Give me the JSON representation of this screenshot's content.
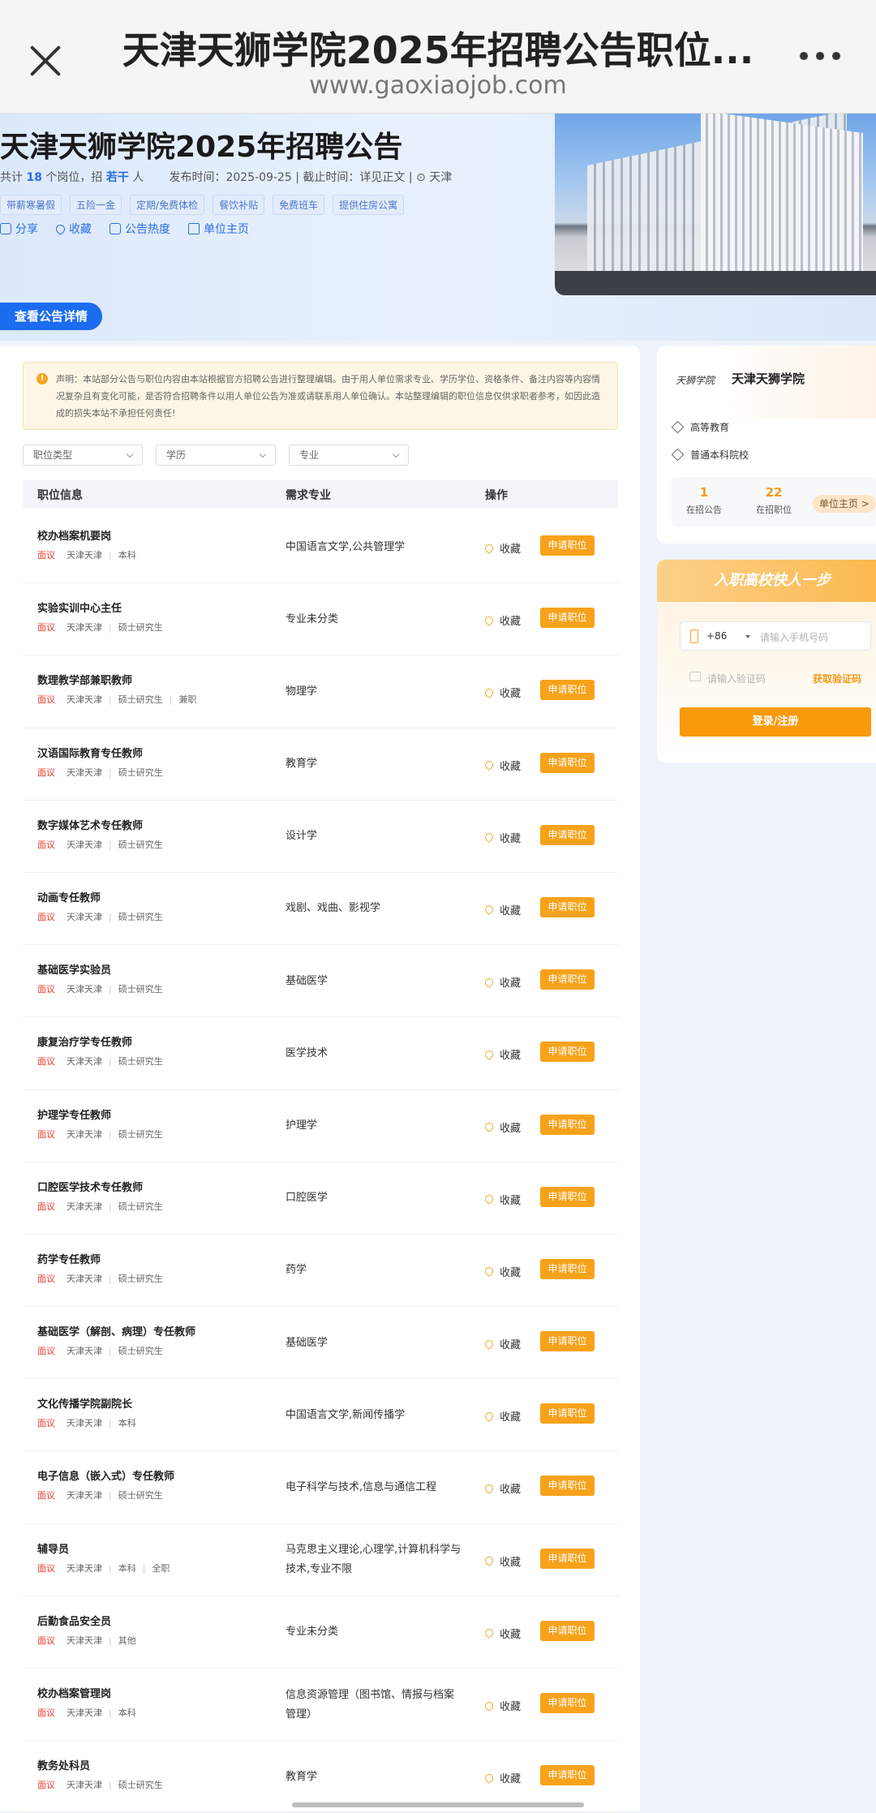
{
  "browser": {
    "title": "天津天狮学院2025年招聘公告职位...",
    "url": "www.gaoxiaojob.com"
  },
  "hero": {
    "title": "天津天狮学院2025年招聘公告",
    "meta_prefix": "共计",
    "positions_count": "18",
    "meta_mid": "个岗位，招",
    "people": "若干",
    "meta_suffix": "人",
    "publish_time": "发布时间：2025-09-25 | 截止时间：详见正文 |",
    "location": "天津",
    "tags": [
      "带薪寒暑假",
      "五险一金",
      "定期/免费体检",
      "餐饮补贴",
      "免费班车",
      "提供住房公寓"
    ],
    "actions": {
      "share": "分享",
      "favorite": "收藏",
      "heat": "公告热度",
      "unit_home": "单位主页"
    },
    "detail_button": "查看公告详情"
  },
  "notice": "声明：本站部分公告与职位内容由本站根据官方招聘公告进行整理编辑。由于用人单位需求专业、学历学位、资格条件、备注内容等内容情况复杂且有变化可能，是否符合招聘条件以用人单位公告为准或请联系用人单位确认。本站整理编辑的职位信息仅供求职者参考，如因此造成的损失本站不承担任何责任!",
  "filters": [
    "职位类型",
    "学历",
    "专业"
  ],
  "table": {
    "headers": [
      "职位信息",
      "需求专业",
      "操作"
    ],
    "fav_label": "收藏",
    "apply_label": "申请职位",
    "rows": [
      {
        "name": "校办档案机要岗",
        "salary": "面议",
        "city": "天津天津",
        "edu": "本科",
        "extra": "",
        "major": "中国语言文学,公共管理学"
      },
      {
        "name": "实验实训中心主任",
        "salary": "面议",
        "city": "天津天津",
        "edu": "硕士研究生",
        "extra": "",
        "major": "专业未分类"
      },
      {
        "name": "数理教学部兼职教师",
        "salary": "面议",
        "city": "天津天津",
        "edu": "硕士研究生",
        "extra": "兼职",
        "major": "物理学"
      },
      {
        "name": "汉语国际教育专任教师",
        "salary": "面议",
        "city": "天津天津",
        "edu": "硕士研究生",
        "extra": "",
        "major": "教育学"
      },
      {
        "name": "数字媒体艺术专任教师",
        "salary": "面议",
        "city": "天津天津",
        "edu": "硕士研究生",
        "extra": "",
        "major": "设计学"
      },
      {
        "name": "动画专任教师",
        "salary": "面议",
        "city": "天津天津",
        "edu": "硕士研究生",
        "extra": "",
        "major": "戏剧、戏曲、影视学"
      },
      {
        "name": "基础医学实验员",
        "salary": "面议",
        "city": "天津天津",
        "edu": "硕士研究生",
        "extra": "",
        "major": "基础医学"
      },
      {
        "name": "康复治疗学专任教师",
        "salary": "面议",
        "city": "天津天津",
        "edu": "硕士研究生",
        "extra": "",
        "major": "医学技术"
      },
      {
        "name": "护理学专任教师",
        "salary": "面议",
        "city": "天津天津",
        "edu": "硕士研究生",
        "extra": "",
        "major": "护理学"
      },
      {
        "name": "口腔医学技术专任教师",
        "salary": "面议",
        "city": "天津天津",
        "edu": "硕士研究生",
        "extra": "",
        "major": "口腔医学"
      },
      {
        "name": "药学专任教师",
        "salary": "面议",
        "city": "天津天津",
        "edu": "硕士研究生",
        "extra": "",
        "major": "药学"
      },
      {
        "name": "基础医学（解剖、病理）专任教师",
        "salary": "面议",
        "city": "天津天津",
        "edu": "硕士研究生",
        "extra": "",
        "major": "基础医学"
      },
      {
        "name": "文化传播学院副院长",
        "salary": "面议",
        "city": "天津天津",
        "edu": "本科",
        "extra": "",
        "major": "中国语言文学,新闻传播学"
      },
      {
        "name": "电子信息（嵌入式）专任教师",
        "salary": "面议",
        "city": "天津天津",
        "edu": "硕士研究生",
        "extra": "",
        "major": "电子科学与技术,信息与通信工程"
      },
      {
        "name": "辅导员",
        "salary": "面议",
        "city": "天津天津",
        "edu": "本科",
        "extra": "全职",
        "major": "马克思主义理论,心理学,计算机科学与技术,专业不限"
      },
      {
        "name": "后勤食品安全员",
        "salary": "面议",
        "city": "天津天津",
        "edu": "其他",
        "extra": "",
        "major": "专业未分类"
      },
      {
        "name": "校办档案管理岗",
        "salary": "面议",
        "city": "天津天津",
        "edu": "本科",
        "extra": "",
        "major": "信息资源管理（图书馆、情报与档案管理）"
      },
      {
        "name": "教务处科员",
        "salary": "面议",
        "city": "天津天津",
        "edu": "硕士研究生",
        "extra": "",
        "major": "教育学"
      }
    ]
  },
  "unit": {
    "logo_text": "天狮学院",
    "name": "天津天狮学院",
    "category": "高等教育",
    "type": "普通本科院校",
    "stats": [
      {
        "value": "1",
        "label": "在招公告"
      },
      {
        "value": "22",
        "label": "在招职位"
      }
    ],
    "home_button": "单位主页 >"
  },
  "login": {
    "heading": "入职高校快人一步",
    "country_code": "+86",
    "phone_placeholder": "请输入手机号码",
    "code_placeholder": "请输入验证码",
    "get_code": "获取验证码",
    "submit": "登录/注册"
  }
}
